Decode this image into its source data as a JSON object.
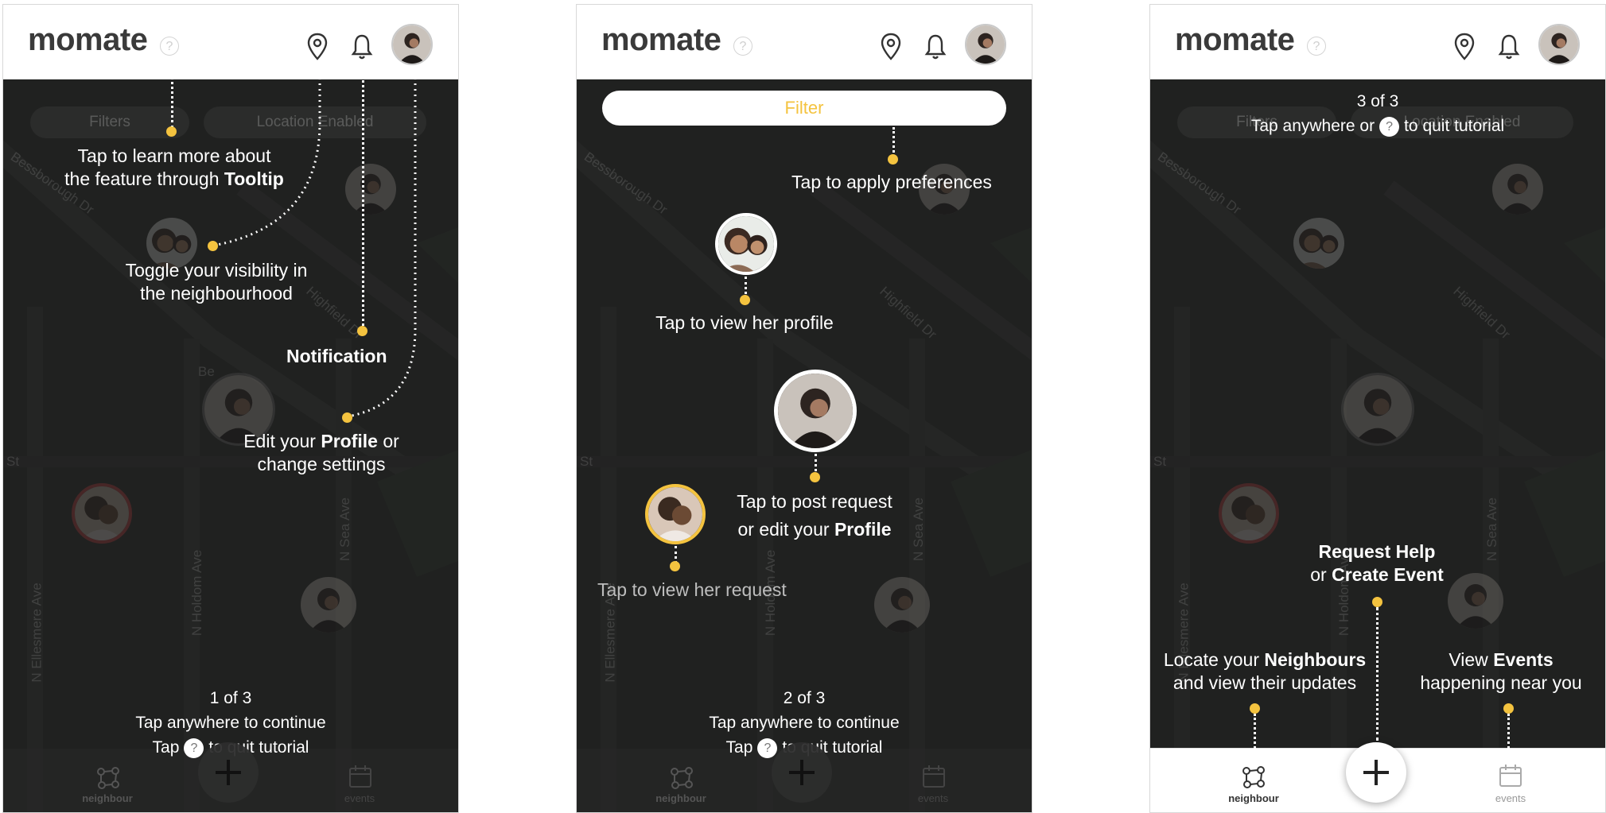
{
  "app": {
    "title": "momate",
    "help_glyph": "?"
  },
  "screens": [
    {
      "filters_label": "Filters",
      "location_label": "Location Enabled",
      "tips": {
        "tooltip_a": "Tap to learn more about",
        "tooltip_b": "the feature through ",
        "tooltip_bold": "Tooltip",
        "visibility_a": "Toggle your visibility in",
        "visibility_b": "the neighbourhood",
        "notification": "Notification",
        "profile_a": "Edit your ",
        "profile_bold": "Profile",
        "profile_b": " or",
        "profile_c": "change settings"
      },
      "progress": "1 of 3",
      "continue_text": "Tap anywhere to continue",
      "quit_prefix": "Tap",
      "quit_suffix": "to quit tutorial",
      "nav": {
        "neighbour": "neighbour",
        "events": "events"
      }
    },
    {
      "filter_button": "Filter",
      "tips": {
        "apply": "Tap to apply preferences",
        "view_profile": "Tap to view her profile",
        "post_a": "Tap to post request",
        "post_b": "or edit your ",
        "post_bold": "Profile",
        "view_request": "Tap to view her request"
      },
      "progress": "2 of 3",
      "continue_text": "Tap anywhere to continue",
      "quit_prefix": "Tap",
      "quit_suffix": "to quit tutorial",
      "nav": {
        "neighbour": "neighbour",
        "events": "events"
      }
    },
    {
      "filters_label": "Filters",
      "location_label": "Location Enabled",
      "progress": "3 of 3",
      "quit_prefix": "Tap anywhere or",
      "quit_suffix": "to quit tutorial",
      "tips": {
        "request_bold": "Request Help",
        "create_prefix": "or ",
        "create_bold": "Create Event",
        "locate_a": "Locate your ",
        "locate_bold": "Neighbours",
        "locate_b": "and view their updates",
        "view_a": "View ",
        "view_bold": "Events",
        "view_b": "happening near you"
      },
      "nav": {
        "neighbour": "neighbour",
        "events": "events"
      }
    }
  ],
  "map_streets": [
    "Bessborough Dr",
    "Highfield Dr",
    "N Ellesmere Ave",
    "N Holdom Ave",
    "N Sea Ave",
    "St",
    "Be"
  ],
  "colors": {
    "accent": "#f4c33f",
    "header_bg": "#ffffff",
    "map_bg": "#2a2b2a"
  },
  "icons": [
    "help-icon",
    "location-pin-icon",
    "bell-icon",
    "neighbour-icon",
    "plus-icon",
    "calendar-icon"
  ]
}
